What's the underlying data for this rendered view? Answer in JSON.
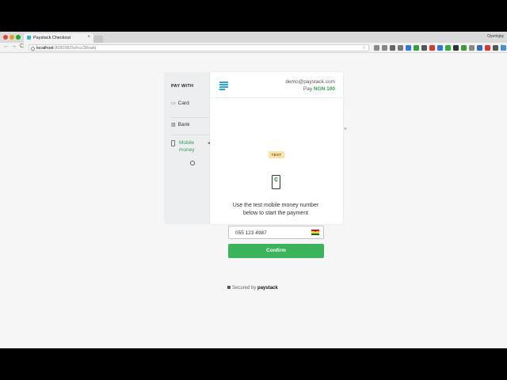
{
  "browser": {
    "tab_title": "Paystack Checkout",
    "tab_close": "×",
    "profile_name": "Oyemijoy",
    "url_host": "localhost",
    "url_path": ":8080/8l2hzhcx38oalq",
    "nav": {
      "back": "←",
      "forward": "→",
      "reload": "C"
    },
    "star": "☆",
    "menu": "⋮",
    "extension_colors": [
      "#888888",
      "#888888",
      "#666666",
      "#777777",
      "#2a7ae2",
      "#3c9a3c",
      "#555555",
      "#d23c2e",
      "#2a7ae2",
      "#38a83a",
      "#333333",
      "#3c9a3c",
      "#888888",
      "#2f6db6",
      "#d23c2e",
      "#555555",
      "#4a90d9",
      "#777777",
      "#888888"
    ]
  },
  "sidebar": {
    "title": "PAY WITH",
    "methods": [
      {
        "label": "Card",
        "icon": "card-icon"
      },
      {
        "label": "Bank",
        "icon": "bank-icon"
      },
      {
        "label": "Mobile money",
        "icon": "mobile-icon"
      }
    ]
  },
  "checkout": {
    "email": "demo@paystack.com",
    "pay_prefix": "Pay",
    "amount": "NGN 100",
    "test_badge": "TEST",
    "instruction": "Use the test mobile money number below to start the payment",
    "phone_value": "055 123 4987",
    "confirm_label": "Confirm",
    "close": "×"
  },
  "footer": {
    "secured_text": "Secured by",
    "brand": "paystack"
  },
  "colors": {
    "accent_green": "#3bb35a",
    "brand_blue": "#2aa6d6",
    "test_badge_bg": "#fbe2a6"
  }
}
